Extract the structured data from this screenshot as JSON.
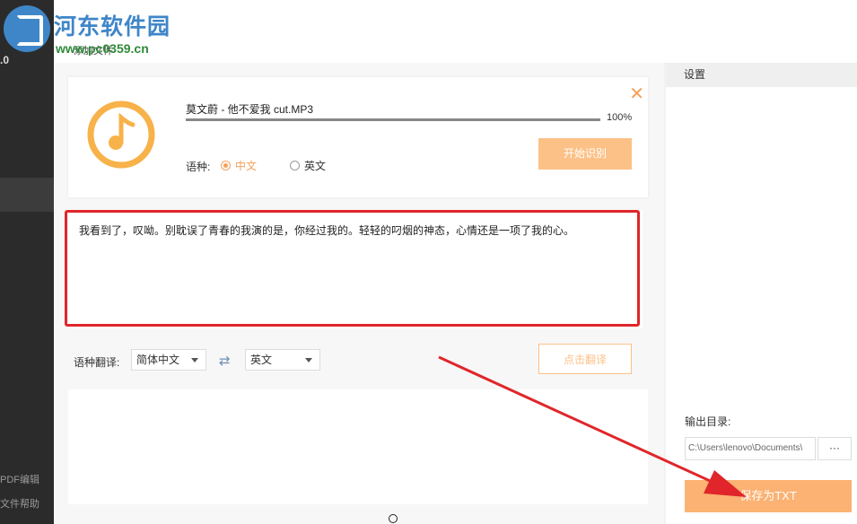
{
  "watermark": {
    "brand": "河东软件园",
    "url": "www.pc0359.cn"
  },
  "sidebar": {
    "version": ".0",
    "footer_items": [
      "PDF编辑",
      "文件帮助"
    ]
  },
  "topbar": {
    "add_label": "添加文件"
  },
  "file": {
    "name": "莫文蔚 - 他不爱我 cut.MP3",
    "progress_percent": 100,
    "progress_label": "100%",
    "language_label": "语种:",
    "language_options": [
      "中文",
      "英文"
    ],
    "language_selected": "中文",
    "start_label": "开始识别"
  },
  "result": {
    "text": "我看到了，叹呦。别耽误了青春的我演的是，你经过我的。轻轻的叼烟的神态，心情还是一项了我的心。"
  },
  "translate": {
    "label": "语种翻译:",
    "from": "简体中文",
    "to": "英文",
    "button_label": "点击翻译"
  },
  "settings": {
    "title": "设置",
    "output_label": "输出目录:",
    "output_path": "C:\\Users\\lenovo\\Documents\\",
    "browse_label": "···",
    "save_label": "保存为TXT"
  },
  "colors": {
    "accent": "#f5a05a",
    "highlight_frame": "#e0262a",
    "arrow": "#e0262a"
  }
}
